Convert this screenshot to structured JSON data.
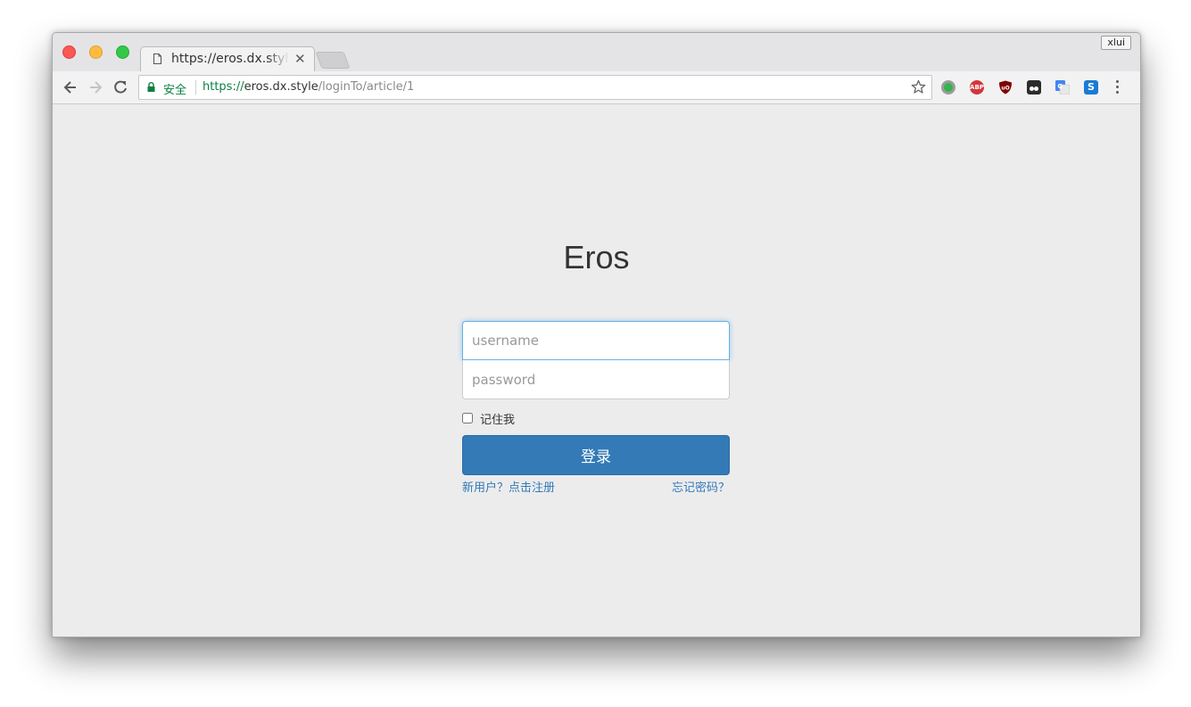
{
  "browser": {
    "tab": {
      "title": "https://eros.dx.style"
    },
    "profile": "xlui",
    "omnibox": {
      "security_label": "安全",
      "url_scheme": "https://",
      "url_host": "eros.dx.style",
      "url_path": "/loginTo/article/1"
    },
    "extensions": [
      "status-icon",
      "ABP",
      "uBlock",
      "tampermonkey",
      "google-translate",
      "S"
    ]
  },
  "page": {
    "title": "Eros",
    "username_placeholder": "username",
    "password_placeholder": "password",
    "remember_label": "记住我",
    "remember_checked": false,
    "login_button": "登录",
    "register_link": "新用户？点击注册",
    "forgot_link": "忘记密码？"
  },
  "colors": {
    "primary": "#337ab7",
    "secure_green": "#0b8043",
    "page_background": "#ececed"
  }
}
